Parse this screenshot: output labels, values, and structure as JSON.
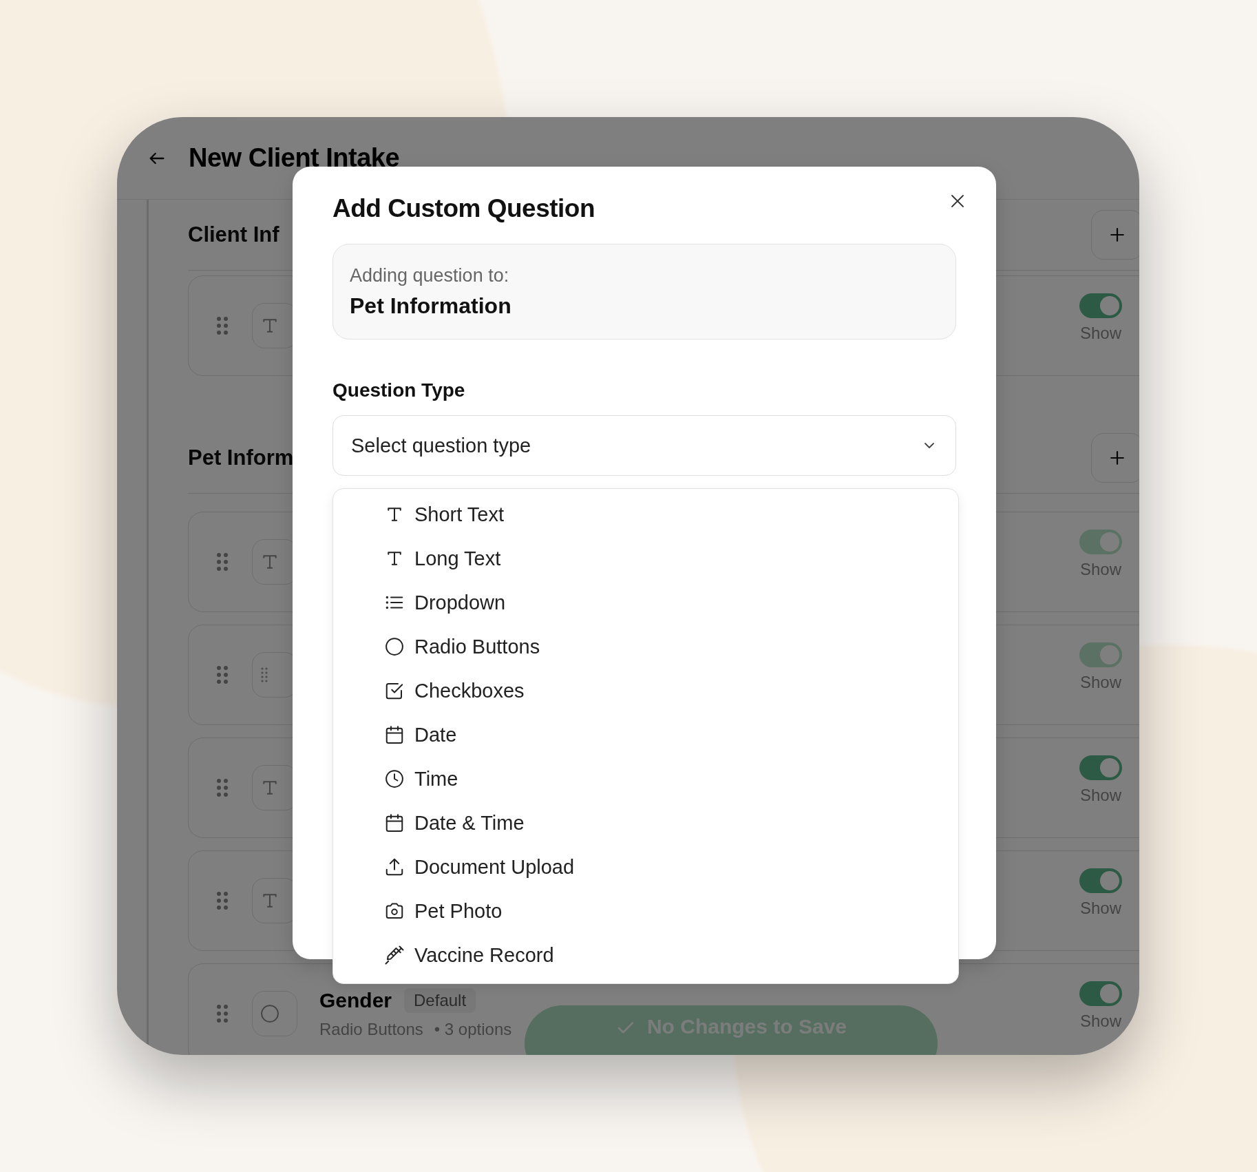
{
  "screen": {
    "title": "New Client Intake"
  },
  "sections": [
    {
      "title": "Client Inf",
      "fields": [
        {
          "kind": "text",
          "on": true,
          "disabled": false,
          "toggle_label": "Show"
        }
      ]
    },
    {
      "title": "Pet Inform",
      "fields": [
        {
          "kind": "text",
          "on": true,
          "disabled": true,
          "toggle_label": "Show"
        },
        {
          "kind": "list",
          "on": true,
          "disabled": true,
          "toggle_label": "Show"
        },
        {
          "kind": "text",
          "on": true,
          "disabled": false,
          "toggle_label": "Show"
        },
        {
          "kind": "text",
          "on": true,
          "disabled": false,
          "toggle_label": "Show"
        },
        {
          "kind": "radio",
          "name": "Gender",
          "badge": "Default",
          "type_label": "Radio Buttons",
          "detail": "• 3 options",
          "on": true,
          "disabled": false,
          "toggle_label": "Show"
        }
      ]
    }
  ],
  "save_bar": {
    "label": "No Changes to Save"
  },
  "modal": {
    "title": "Add Custom Question",
    "target_label": "Adding question to:",
    "target_name": "Pet Information",
    "type_label": "Question Type",
    "prompt": "Select question type",
    "options": [
      {
        "kind": "text",
        "label": "Short Text"
      },
      {
        "kind": "text",
        "label": "Long Text"
      },
      {
        "kind": "list",
        "label": "Dropdown"
      },
      {
        "kind": "circle",
        "label": "Radio Buttons"
      },
      {
        "kind": "check",
        "label": "Checkboxes"
      },
      {
        "kind": "calendar",
        "label": "Date"
      },
      {
        "kind": "clock",
        "label": "Time"
      },
      {
        "kind": "calendar",
        "label": "Date & Time"
      },
      {
        "kind": "upload",
        "label": "Document Upload"
      },
      {
        "kind": "camera",
        "label": "Pet Photo"
      },
      {
        "kind": "syringe",
        "label": "Vaccine Record"
      }
    ]
  }
}
